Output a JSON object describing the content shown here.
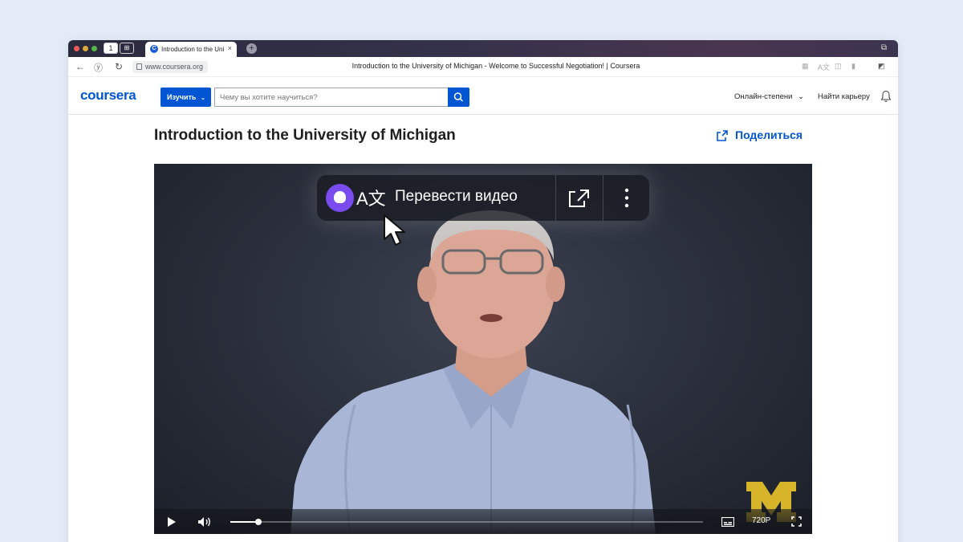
{
  "browser": {
    "tab_title": "Introduction to the Uni",
    "tab_close": "×",
    "new_tab": "+",
    "url": "www.coursera.org",
    "page_title": "Introduction to the University of Michigan - Welcome to Successful Negotiation! | Coursera",
    "tab_count_badge": "1"
  },
  "header": {
    "logo": "coursera",
    "explore_label": "Изучить",
    "search_placeholder": "Чему вы хотите научиться?",
    "online_degrees": "Онлайн-степени",
    "find_career": "Найти карьеру"
  },
  "course": {
    "title": "Introduction to the University of Michigan",
    "share_label": "Поделиться"
  },
  "translate_popup": {
    "glyph": "A文",
    "label": "Перевести видео"
  },
  "player": {
    "progress": 0.06,
    "quality": "720P"
  },
  "colors": {
    "brand": "#0056d2",
    "alice": "#7a4cf0",
    "umich_maize": "#d6b52b"
  }
}
